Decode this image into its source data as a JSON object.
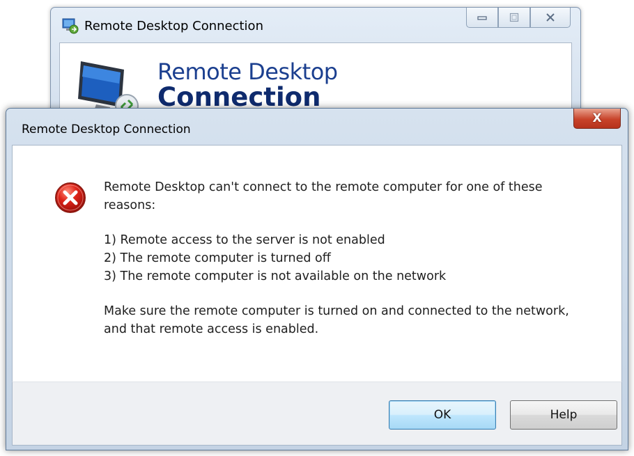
{
  "background_window": {
    "title": "Remote Desktop Connection",
    "app_icon": "remote-desktop-app-icon",
    "caption_buttons": {
      "minimize": "minimize-icon",
      "maximize": "maximize-icon",
      "close": "close-icon"
    },
    "banner": {
      "line1": "Remote Desktop",
      "line2": "Connection",
      "icon": "monitor-remote-icon"
    }
  },
  "dialog": {
    "title": "Remote Desktop Connection",
    "close_label": "X",
    "icon": "error-icon",
    "message": {
      "intro": "Remote Desktop can't connect to the remote computer for one of these reasons:",
      "reasons": [
        "1) Remote access to the server is not enabled",
        "2) The remote computer is turned off",
        "3) The remote computer is not available on the network"
      ],
      "advice": "Make sure the remote computer is turned on and connected to the network, and that remote access is enabled."
    },
    "buttons": {
      "ok": "OK",
      "help": "Help"
    }
  },
  "colors": {
    "banner_text": "#1b3f8f",
    "close_button": "#c8432a",
    "error_icon": "#d0021b",
    "default_button": "#bee6fd"
  }
}
